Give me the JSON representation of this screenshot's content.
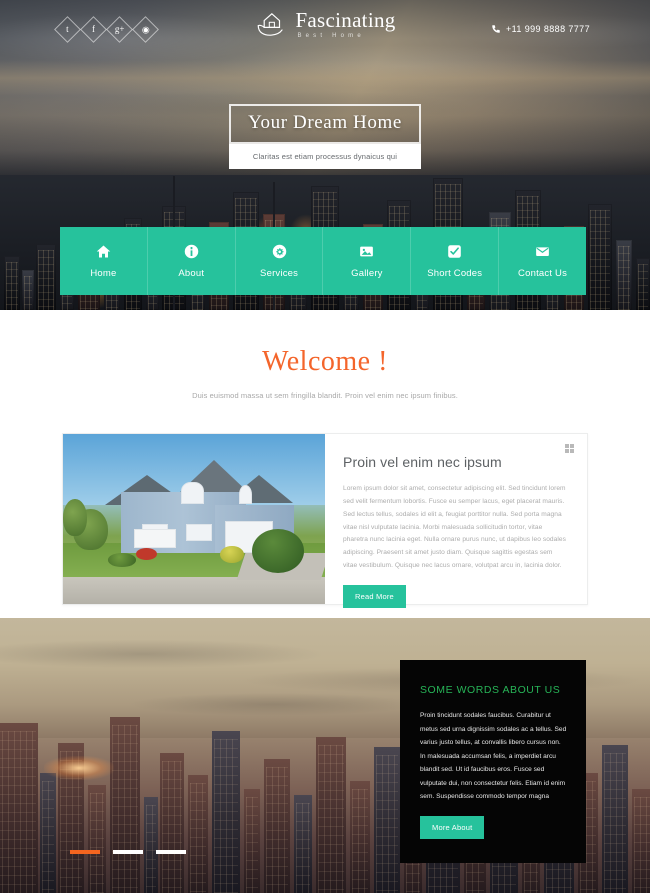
{
  "header": {
    "brand_name": "Fascinating",
    "brand_tagline": "Best Home",
    "brand_logo_icon": "house-in-hand-icon",
    "phone": "+11 999 8888 7777",
    "phone_icon": "phone-icon",
    "social": [
      {
        "name": "twitter",
        "glyph": "t",
        "icon": "twitter-icon"
      },
      {
        "name": "facebook",
        "glyph": "f",
        "icon": "facebook-icon"
      },
      {
        "name": "googleplus",
        "glyph": "g+",
        "icon": "google-plus-icon"
      },
      {
        "name": "dribbble",
        "glyph": "◉",
        "icon": "dribbble-icon"
      }
    ]
  },
  "hero": {
    "title": "Your Dream Home",
    "subtitle": "Claritas est etiam processus dynaicus qui"
  },
  "nav": {
    "items": [
      {
        "label": "Home",
        "icon": "home-icon"
      },
      {
        "label": "About",
        "icon": "info-icon"
      },
      {
        "label": "Services",
        "icon": "gear-icon"
      },
      {
        "label": "Gallery",
        "icon": "image-icon"
      },
      {
        "label": "Short Codes",
        "icon": "check-square-icon"
      },
      {
        "label": "Contact Us",
        "icon": "envelope-icon"
      }
    ]
  },
  "welcome": {
    "heading": "Welcome !",
    "subtext": "Duis euismod massa ut sem fringilla blandit. Proin vel enim nec ipsum finibus."
  },
  "feature_card": {
    "image_alt": "blue two-story suburban house with lawn",
    "grid_icon": "grid-icon",
    "title": "Proin vel enim nec ipsum",
    "body": "Lorem ipsum dolor sit amet, consectetur adipiscing elit. Sed tincidunt lorem sed velit fermentum lobortis. Fusce eu semper lacus, eget placerat mauris. Sed lectus tellus, sodales id elit a, feugiat porttitor nulla. Sed porta magna vitae nisl vulputate lacinia. Morbi malesuada sollicitudin tortor, vitae pharetra nunc lacinia eget. Nulla ornare purus nunc, ut dapibus leo sodales adipiscing. Praesent sit amet justo diam. Quisque sagittis egestas sem vitae vestibulum. Quisque nec lacus ornare, volutpat arcu in, lacinia dolor.",
    "button_label": "Read More"
  },
  "about_section": {
    "title": "SOME WORDS ABOUT US",
    "body": "Proin tincidunt sodales faucibus. Curabitur ut metus sed urna dignissim sodales ac a tellus. Sed varius justo tellus, at convallis libero cursus non. In malesuada accumsan felis, a imperdiet arcu blandit sed. Ut id faucibus eros. Fusce sed vulputate dui, non consectetur felis. Etiam id enim sem. Suspendisse commodo tempor magna",
    "button_label": "More About",
    "slider_dots": [
      {
        "active": true
      },
      {
        "active": false
      },
      {
        "active": false
      }
    ]
  },
  "colors": {
    "accent_teal": "#26c29c",
    "accent_orange": "#f4652b",
    "about_green": "#27b457",
    "panel_black": "#050505"
  }
}
